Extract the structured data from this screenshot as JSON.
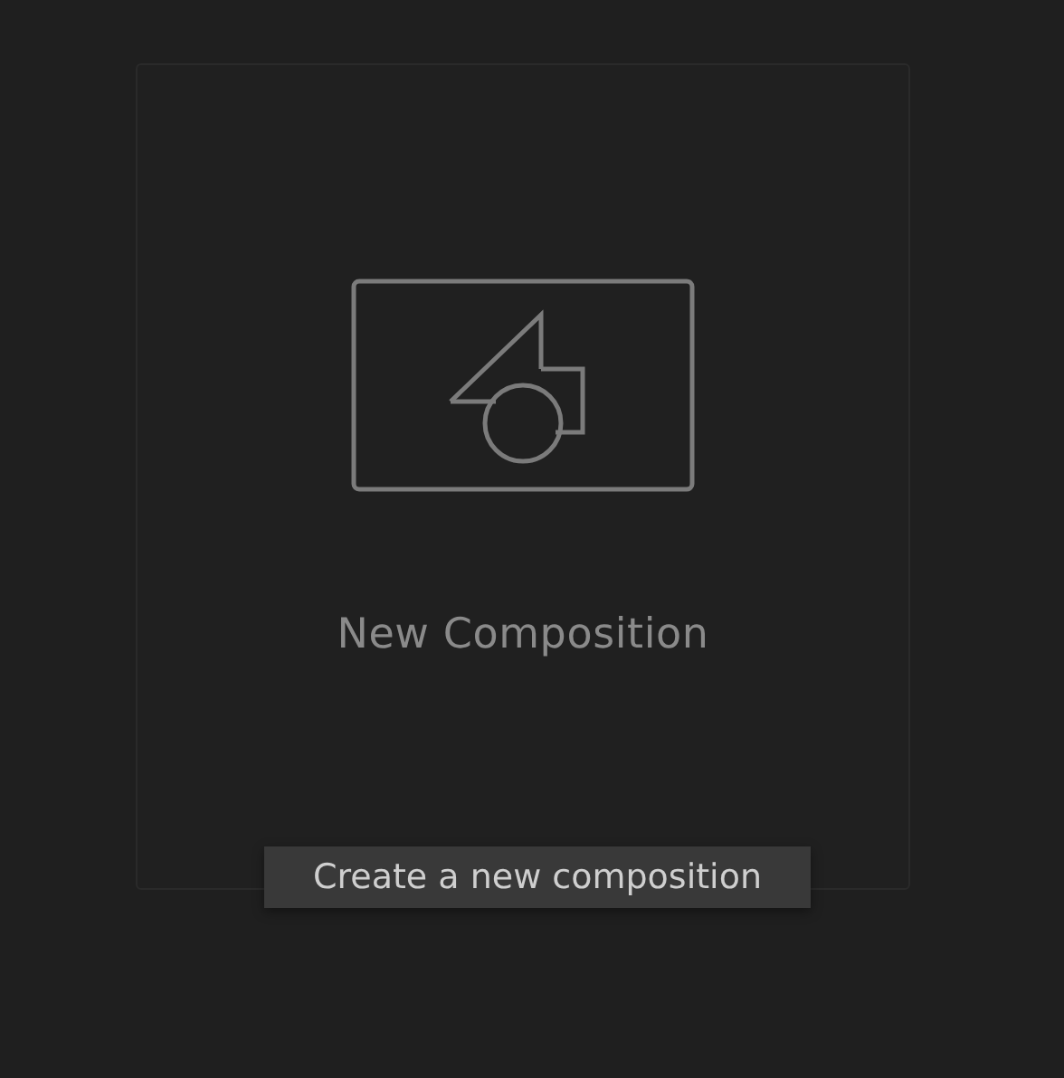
{
  "card": {
    "title": "New Composition"
  },
  "tooltip": {
    "text": "Create a new composition"
  }
}
